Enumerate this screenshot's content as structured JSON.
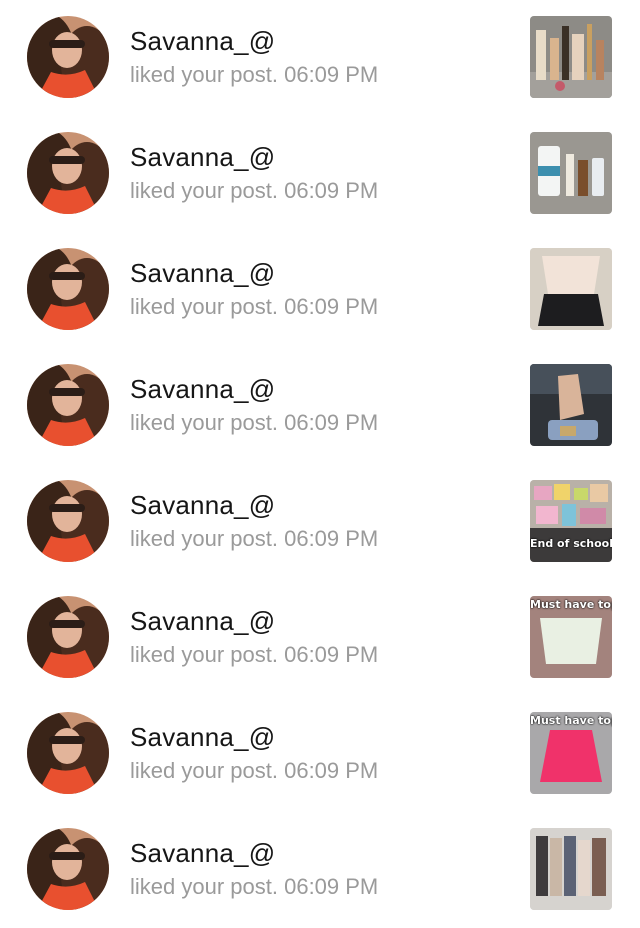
{
  "notifications": [
    {
      "user": "Savanna_@",
      "action": "liked your post.",
      "time": "06:09 PM",
      "thumb": "makeup-products-thumbnail",
      "caption": ""
    },
    {
      "user": "Savanna_@",
      "action": "liked your post.",
      "time": "06:09 PM",
      "thumb": "skincare-products-thumbnail",
      "caption": ""
    },
    {
      "user": "Savanna_@",
      "action": "liked your post.",
      "time": "06:09 PM",
      "thumb": "outfit-thumbnail",
      "caption": ""
    },
    {
      "user": "Savanna_@",
      "action": "liked your post.",
      "time": "06:09 PM",
      "thumb": "car-selfie-thumbnail",
      "caption": ""
    },
    {
      "user": "Savanna_@",
      "action": "liked your post.",
      "time": "06:09 PM",
      "thumb": "school-haul-thumbnail",
      "caption": "End of school"
    },
    {
      "user": "Savanna_@",
      "action": "liked your post.",
      "time": "06:09 PM",
      "thumb": "white-top-thumbnail",
      "caption": "Must have top"
    },
    {
      "user": "Savanna_@",
      "action": "liked your post.",
      "time": "06:09 PM",
      "thumb": "pink-top-thumbnail",
      "caption": "Must have top"
    },
    {
      "user": "Savanna_@",
      "action": "liked your post.",
      "time": "06:09 PM",
      "thumb": "clothes-rack-thumbnail",
      "caption": ""
    }
  ]
}
